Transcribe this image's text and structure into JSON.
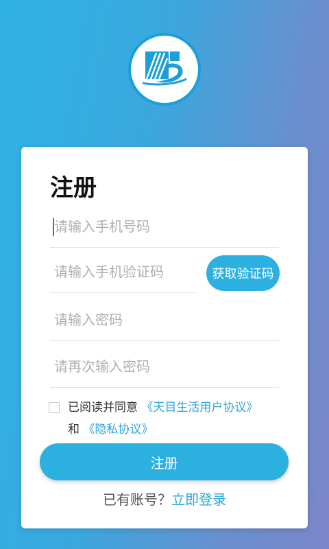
{
  "logo": {
    "icon": "tianmu-logo-icon",
    "accent": "#1a9fd8"
  },
  "form": {
    "title": "注册",
    "phone_placeholder": "请输入手机号码",
    "code_placeholder": "请输入手机验证码",
    "get_code_label": "获取验证码",
    "password_placeholder": "请输入密码",
    "confirm_placeholder": "请再次输入密码",
    "agree_prefix": "已阅读并同意",
    "user_agreement": "《天目生活用户协议》",
    "agree_and": "和",
    "privacy_agreement": "《隐私协议》",
    "submit_label": "注册",
    "has_account": "已有账号？",
    "login_link": "立即登录"
  },
  "colors": {
    "primary": "#2bb0e0",
    "link": "#2aa6d8"
  }
}
